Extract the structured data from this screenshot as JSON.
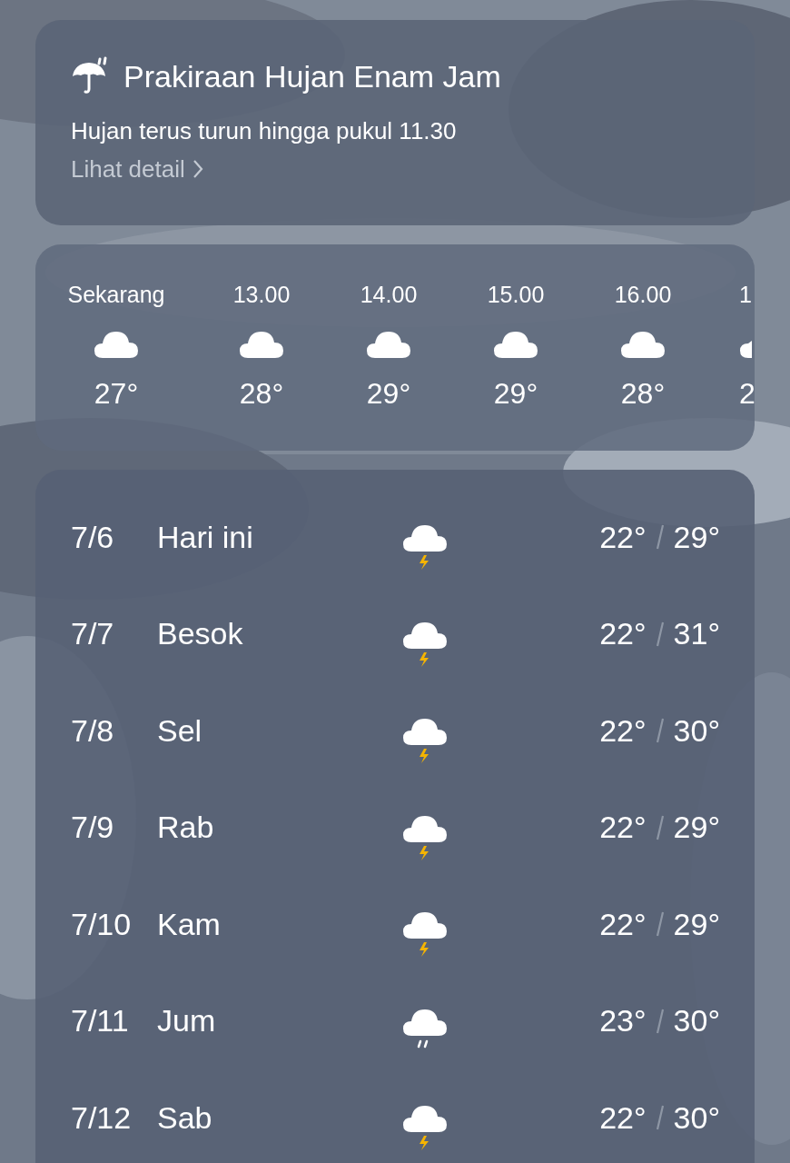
{
  "rain_card": {
    "title": "Prakiraan Hujan Enam Jam",
    "message": "Hujan terus turun hingga pukul 11.30",
    "link": "Lihat detail"
  },
  "hourly": [
    {
      "time": "Sekarang",
      "temp": "27°"
    },
    {
      "time": "13.00",
      "temp": "28°"
    },
    {
      "time": "14.00",
      "temp": "29°"
    },
    {
      "time": "15.00",
      "temp": "29°"
    },
    {
      "time": "16.00",
      "temp": "28°"
    },
    {
      "time": "1",
      "temp": "2"
    }
  ],
  "daily": [
    {
      "date": "7/6",
      "day": "Hari ini",
      "kind": "thunder",
      "low": "22°",
      "high": "29°"
    },
    {
      "date": "7/7",
      "day": "Besok",
      "kind": "thunder",
      "low": "22°",
      "high": "31°"
    },
    {
      "date": "7/8",
      "day": "Sel",
      "kind": "thunder",
      "low": "22°",
      "high": "30°"
    },
    {
      "date": "7/9",
      "day": "Rab",
      "kind": "thunder",
      "low": "22°",
      "high": "29°"
    },
    {
      "date": "7/10",
      "day": "Kam",
      "kind": "thunder",
      "low": "22°",
      "high": "29°"
    },
    {
      "date": "7/11",
      "day": "Jum",
      "kind": "rain",
      "low": "23°",
      "high": "30°"
    },
    {
      "date": "7/12",
      "day": "Sab",
      "kind": "thunder",
      "low": "22°",
      "high": "30°"
    }
  ]
}
